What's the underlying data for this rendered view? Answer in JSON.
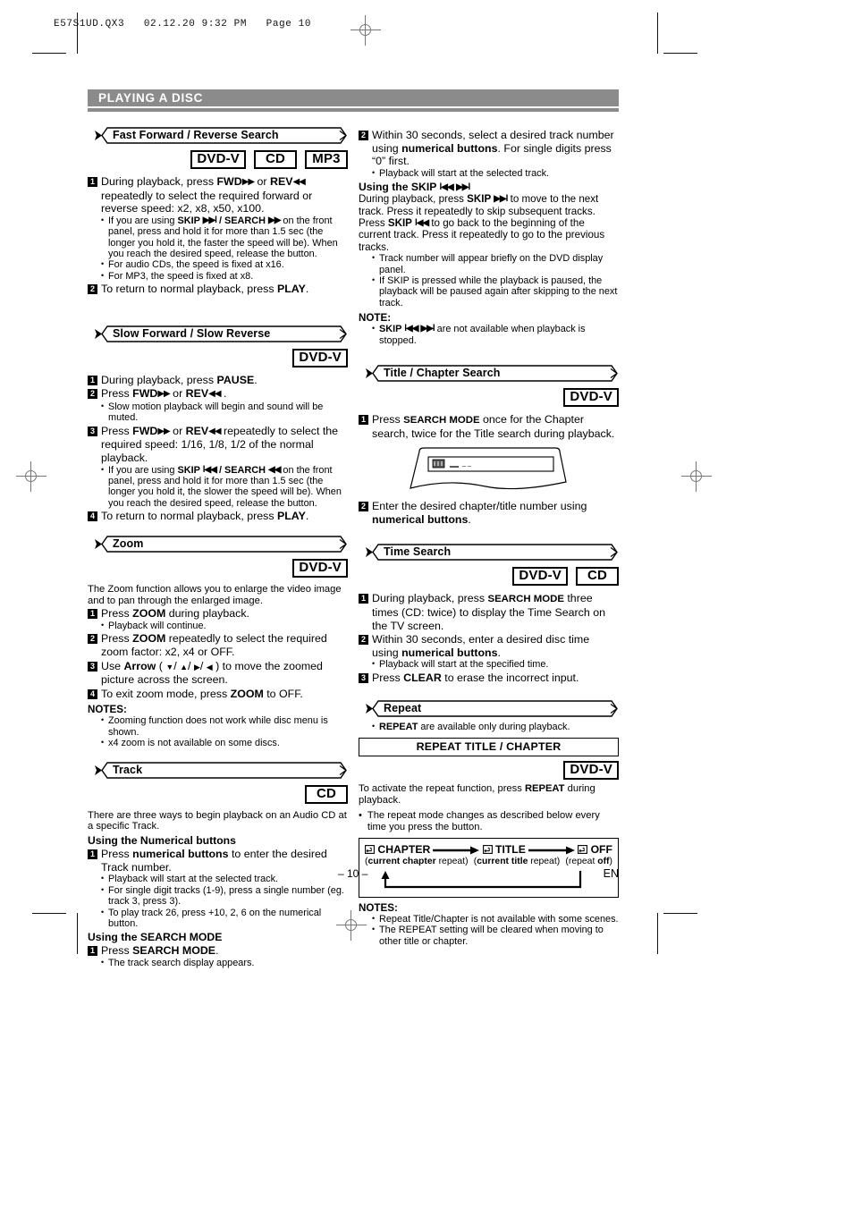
{
  "print_marks": {
    "header_line": "E57S1UD.QX3   02.12.20 9:32 PM   Page 10"
  },
  "chapter": {
    "title": "PLAYING A DISC"
  },
  "footer": {
    "page_number": "– 10 –",
    "language": "EN"
  },
  "badge_labels": {
    "dvdv": "DVD-V",
    "cd": "CD",
    "mp3": "MP3"
  },
  "left_column": {
    "sections": [
      {
        "title": "Fast Forward / Reverse Search",
        "badges": [
          "DVD-V",
          "CD",
          "MP3"
        ],
        "steps": [
          {
            "no": "1",
            "text": "During playback, press FWD▶▶ or REV◀◀ repeatedly to select the required forward or reverse speed: x2, x8, x50, x100."
          },
          {
            "no": "2",
            "text": "To return to normal playback, press PLAY."
          }
        ],
        "bullets_after_step1": [
          "If you are using SKIP ▶▶l / SEARCH ▶▶ on the front panel, press and hold it for more than 1.5 sec (the longer you hold it, the faster the speed will be).  When you reach the desired speed, release the button.",
          "For audio CDs, the speed is fixed at x16.",
          "For MP3, the speed is fixed at x8."
        ]
      },
      {
        "title": "Slow Forward / Slow Reverse",
        "badges": [
          "DVD-V"
        ],
        "steps": [
          {
            "no": "1",
            "text": "During playback, press PAUSE."
          },
          {
            "no": "2",
            "text": "Press FWD▶▶ or REV◀◀ ."
          },
          {
            "no": "3",
            "text": "Press FWD▶▶ or REV◀◀ repeatedly to select the required speed: 1/16, 1/8, 1/2 of the normal playback."
          },
          {
            "no": "4",
            "text": "To return to normal playback, press PLAY."
          }
        ],
        "bullet_after_step2": "Slow motion playback will begin and sound will be muted.",
        "bullet_after_step3": "If you are using SKIP l◀◀ / SEARCH ◀◀ on the front panel, press and hold it for more than 1.5 sec (the longer you hold it, the slower the speed will be).  When you reach the desired speed, release the button."
      },
      {
        "title": "Zoom",
        "badges": [
          "DVD-V"
        ],
        "intro": "The Zoom function allows you to enlarge the video image and to pan through the enlarged image.",
        "steps": [
          {
            "no": "1",
            "text": "Press ZOOM during playback."
          },
          {
            "no": "2",
            "text": "Press ZOOM repeatedly to select the required zoom factor: x2, x4 or OFF."
          },
          {
            "no": "3",
            "text": "Use Arrow ( ▼/ ▲/ ▶/ ◀ ) to move the zoomed picture across the screen."
          },
          {
            "no": "4",
            "text": "To exit zoom mode, press ZOOM to OFF."
          }
        ],
        "bullet_after_step1": "Playback will continue.",
        "notes_heading": "NOTES:",
        "notes": [
          "Zooming function does not work while disc menu is shown.",
          "x4 zoom is not available on some discs."
        ]
      },
      {
        "title": "Track",
        "badges": [
          "CD"
        ],
        "intro": "There are three ways to begin playback on an Audio CD at a specific Track.",
        "sub1_heading": "Using the Numerical buttons",
        "sub1_step": {
          "no": "1",
          "text": "Press numerical buttons to enter the desired Track number."
        },
        "sub1_bullets": [
          "Playback will start at the selected track.",
          "For single digit tracks (1-9), press a single number (eg. track 3, press 3).",
          "To play track 26, press +10, 2, 6 on the numerical button."
        ],
        "sub2_heading": "Using the SEARCH MODE",
        "sub2_step": {
          "no": "1",
          "text": "Press SEARCH MODE."
        },
        "sub2_bullets": [
          "The track search display appears."
        ]
      }
    ]
  },
  "right_column": {
    "continued": {
      "step": {
        "no": "2",
        "text": "Within 30 seconds, select a desired track number using numerical buttons.  For single digits press “0” first."
      },
      "bullet": "Playback will start at the selected track.",
      "skip_heading": "Using the SKIP l◀◀ ▶▶l",
      "skip_para": "During playback, press SKIP ▶▶l to move to the next track. Press it repeatedly to skip subsequent tracks.  Press SKIP l◀◀ to go back to the beginning of the current track.  Press it repeatedly to go to the previous tracks.",
      "skip_bullets": [
        "Track number will appear briefly on the DVD display panel.",
        "If SKIP is pressed while the playback is paused, the playback will be paused again after skipping to the next track."
      ],
      "note_heading": "NOTE:",
      "note_bullets": [
        "SKIP l◀◀ ▶▶l are not available when playback is stopped."
      ]
    },
    "sections": [
      {
        "title": "Title / Chapter Search",
        "badges": [
          "DVD-V"
        ],
        "steps": [
          {
            "no": "1",
            "text": "Press SEARCH MODE once for the Chapter search, twice for the Title search during playback."
          },
          {
            "no": "2",
            "text": "Enter the desired chapter/title number using numerical buttons."
          }
        ],
        "illustration": {
          "name": "dvd-display-panel",
          "field_text": "_ _"
        }
      },
      {
        "title": "Time Search",
        "badges": [
          "DVD-V",
          "CD"
        ],
        "steps": [
          {
            "no": "1",
            "text": "During playback, press SEARCH MODE three times (CD: twice) to display the Time Search on the TV screen."
          },
          {
            "no": "2",
            "text": "Within 30 seconds, enter a desired disc time using numerical buttons."
          },
          {
            "no": "3",
            "text": "Press CLEAR to erase the incorrect input."
          }
        ],
        "bullet_after_step2": "Playback will start at the specified time."
      },
      {
        "title": "Repeat",
        "badges": [],
        "bullets": [
          "REPEAT are available only during playback."
        ],
        "repeat_box_title": "REPEAT TITLE / CHAPTER",
        "repeat_badges": [
          "DVD-V"
        ],
        "repeat_intro": "To activate the repeat function, press REPEAT during playback.",
        "repeat_bullet": "The repeat mode changes as described below every time you press the button.",
        "diagram": {
          "nodes": [
            {
              "label": "CHAPTER",
              "caption_bold": "current chapter",
              "caption_rest": " repeat"
            },
            {
              "label": "TITLE",
              "caption_bold": "current title",
              "caption_rest": " repeat"
            },
            {
              "label": "OFF",
              "caption_pre": "repeat ",
              "caption_bold": "off"
            }
          ]
        },
        "notes_heading": "NOTES:",
        "notes": [
          "Repeat Title/Chapter is not available with some scenes.",
          "The REPEAT setting will be cleared when moving to other title or chapter."
        ]
      }
    ]
  }
}
